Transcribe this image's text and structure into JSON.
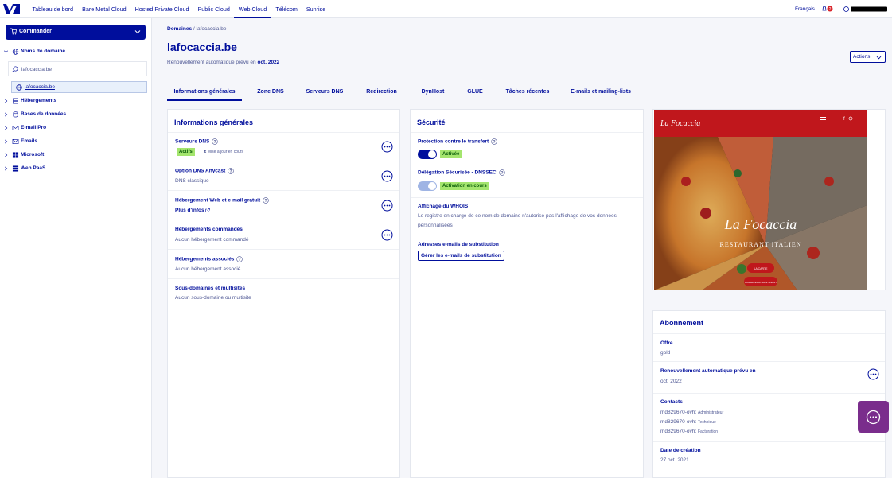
{
  "topnav": {
    "items": [
      "Tableau de bord",
      "Bare Metal Cloud",
      "Hosted Private Cloud",
      "Public Cloud",
      "Web Cloud",
      "Télécom",
      "Sunrise"
    ],
    "active_index": 4,
    "language": "Français",
    "notifications_count": "2"
  },
  "sidebar": {
    "order_label": "Commander",
    "domains_label": "Noms de domaine",
    "search_value": "lafocaccia.be",
    "selected_domain": "lafocaccia.be",
    "items": [
      "Hébergements",
      "Bases de données",
      "E-mail Pro",
      "Emails",
      "Microsoft",
      "Web PaaS"
    ]
  },
  "header": {
    "breadcrumb_root": "Domaines",
    "breadcrumb_sep": "/",
    "breadcrumb_current": "lafocaccia.be",
    "title": "lafocaccia.be",
    "renew_prefix": "Renouvellement automatique prévu en",
    "renew_date": "oct. 2022",
    "actions_label": "Actions"
  },
  "tabs": [
    "Informations générales",
    "Zone DNS",
    "Serveurs DNS",
    "Redirection",
    "DynHost",
    "GLUE",
    "Tâches récentes",
    "E-mails et mailing-lists"
  ],
  "general": {
    "title": "Informations générales",
    "dns_servers_label": "Serveurs DNS",
    "dns_status": "Actifs",
    "dns_update": "Mise à jour en cours",
    "anycast_label": "Option DNS Anycast",
    "anycast_value": "DNS classique",
    "hosting_free_label": "Hébergement Web et e-mail gratuit",
    "more_info": "Plus d'infos",
    "hosting_ordered_label": "Hébergements commandés",
    "hosting_ordered_value": "Aucun hébergement commandé",
    "hosting_assoc_label": "Hébergements associés",
    "hosting_assoc_value": "Aucun hébergement associé",
    "subdomains_label": "Sous-domaines et multisites",
    "subdomains_value": "Aucun sous-domaine ou multisite"
  },
  "security": {
    "title": "Sécurité",
    "transfer_label": "Protection contre le transfert",
    "transfer_status": "Activée",
    "dnssec_label": "Délégation Sécurisée - DNSSEC",
    "dnssec_status": "Activation en cours",
    "whois_label": "Affichage du WHOIS",
    "whois_text_1": "Le registre en charge de ce nom de domaine n'autorise pas l'affichage de vos données",
    "whois_text_2": "personnalisées",
    "email_sub_label": "Adresses e-mails de substitution",
    "email_sub_button": "Gérer les e-mails de substitution"
  },
  "promo": {
    "brand": "La Focaccia",
    "big_title": "La Focaccia",
    "subtitle": "RESTAURANT ITALIEN",
    "btn1": "LA CARTE",
    "btn2": "COMMANDER MAINTENANT"
  },
  "subscription": {
    "title": "Abonnement",
    "offer_label": "Offre",
    "offer_value": "gold",
    "renew_label": "Renouvellement automatique prévu en",
    "renew_value": "oct. 2022",
    "contacts_label": "Contacts",
    "contacts": [
      {
        "id": "md829670-ovh",
        "role": "Administrateur"
      },
      {
        "id": "md829670-ovh",
        "role": "Technique"
      },
      {
        "id": "md829670-ovh",
        "role": "Facturation"
      }
    ],
    "created_label": "Date de création",
    "created_value": "27 oct. 2021"
  },
  "colors": {
    "primary": "#000e9c",
    "success": "#a4e56e",
    "help_purple": "#7a2d8c",
    "promo_red": "#c0171c"
  }
}
